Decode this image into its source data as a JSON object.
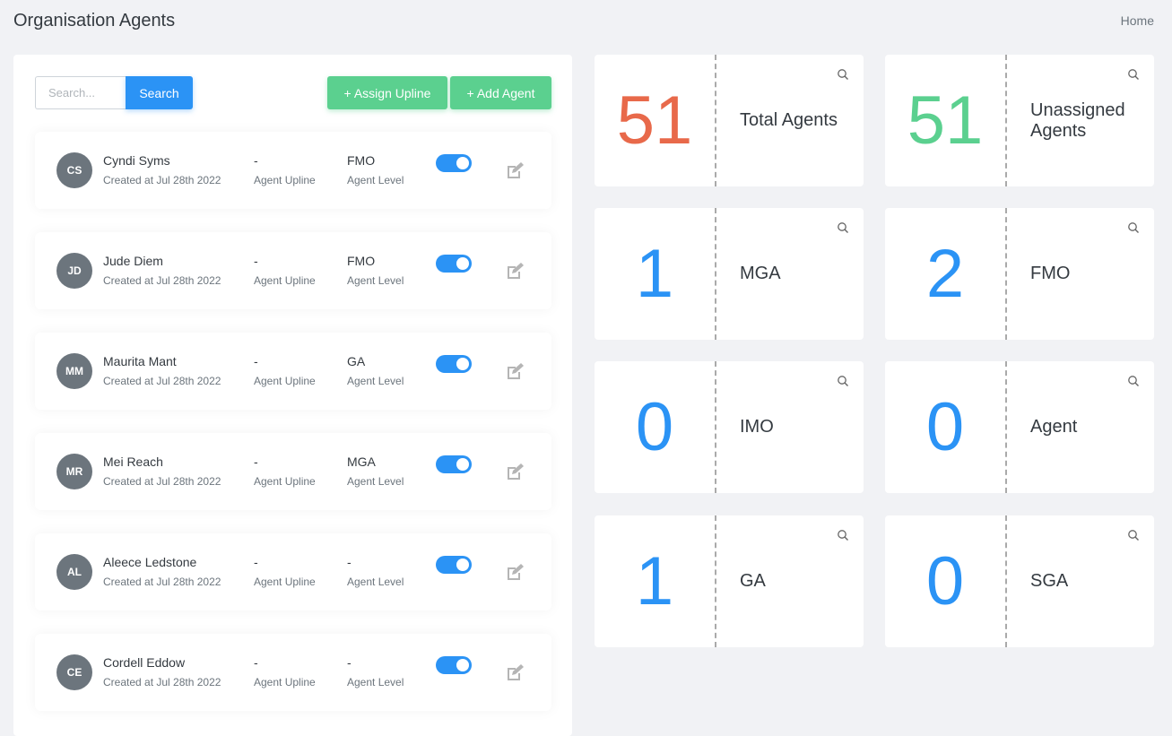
{
  "header": {
    "title": "Organisation Agents",
    "home": "Home"
  },
  "toolbar": {
    "search_placeholder": "Search...",
    "search_label": "Search",
    "assign_label": "+ Assign Upline",
    "add_label": "+ Add Agent"
  },
  "agents": [
    {
      "initials": "CS",
      "name": "Cyndi Syms",
      "created": "Created at Jul 28th 2022",
      "upline": "-",
      "upline_label": "Agent Upline",
      "level": "FMO",
      "level_label": "Agent Level",
      "active": true
    },
    {
      "initials": "JD",
      "name": "Jude Diem",
      "created": "Created at Jul 28th 2022",
      "upline": "-",
      "upline_label": "Agent Upline",
      "level": "FMO",
      "level_label": "Agent Level",
      "active": true
    },
    {
      "initials": "MM",
      "name": "Maurita Mant",
      "created": "Created at Jul 28th 2022",
      "upline": "-",
      "upline_label": "Agent Upline",
      "level": "GA",
      "level_label": "Agent Level",
      "active": true
    },
    {
      "initials": "MR",
      "name": "Mei Reach",
      "created": "Created at Jul 28th 2022",
      "upline": "-",
      "upline_label": "Agent Upline",
      "level": "MGA",
      "level_label": "Agent Level",
      "active": true
    },
    {
      "initials": "AL",
      "name": "Aleece Ledstone",
      "created": "Created at Jul 28th 2022",
      "upline": "-",
      "upline_label": "Agent Upline",
      "level": "-",
      "level_label": "Agent Level",
      "active": true
    },
    {
      "initials": "CE",
      "name": "Cordell Eddow",
      "created": "Created at Jul 28th 2022",
      "upline": "-",
      "upline_label": "Agent Upline",
      "level": "-",
      "level_label": "Agent Level",
      "active": true
    }
  ],
  "stats": [
    {
      "value": "51",
      "label": "Total Agents",
      "color": "#e8694a"
    },
    {
      "value": "51",
      "label": "Unassigned Agents",
      "color": "#5bd08f"
    },
    {
      "value": "1",
      "label": "MGA",
      "color": "#2b93f5"
    },
    {
      "value": "2",
      "label": "FMO",
      "color": "#2b93f5"
    },
    {
      "value": "0",
      "label": "IMO",
      "color": "#2b93f5"
    },
    {
      "value": "0",
      "label": "Agent",
      "color": "#2b93f5"
    },
    {
      "value": "1",
      "label": "GA",
      "color": "#2b93f5"
    },
    {
      "value": "0",
      "label": "SGA",
      "color": "#2b93f5"
    }
  ]
}
